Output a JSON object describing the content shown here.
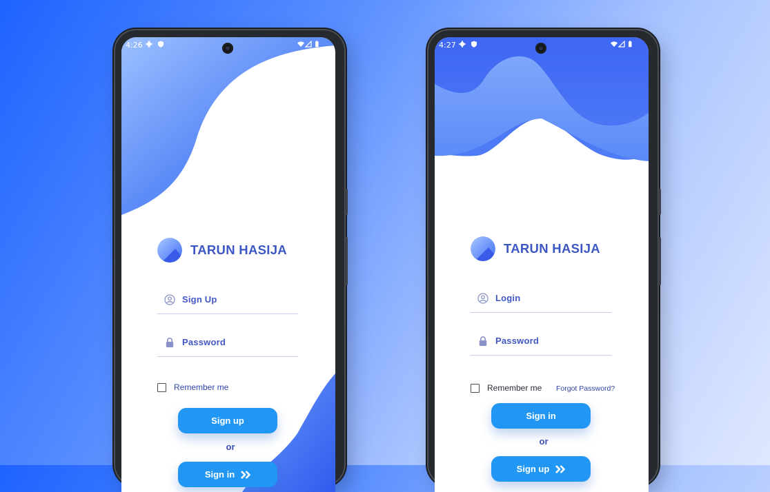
{
  "left_screen": {
    "status_time": "4:26",
    "brand_name": "TARUN HASIJA",
    "username_placeholder": "Sign Up",
    "password_placeholder": "Password",
    "remember_label": "Remember me",
    "primary_button": "Sign up",
    "or_label": "or",
    "secondary_button": "Sign in"
  },
  "right_screen": {
    "status_time": "4:27",
    "brand_name": "TARUN HASIJA",
    "username_placeholder": "Login",
    "password_placeholder": "Password",
    "remember_label": "Remember me",
    "forgot_label": "Forgot Password?",
    "primary_button": "Sign in",
    "or_label": "or",
    "secondary_button": "Sign up"
  },
  "icons": {
    "status": [
      "gear-icon",
      "shield-icon",
      "wifi-icon",
      "signal-icon",
      "battery-icon"
    ],
    "username_field": "user-circle-icon",
    "password_field": "lock-icon",
    "button_arrow": "double-chevron-right-icon"
  },
  "colors": {
    "brand_text": "#3c56c4",
    "wave_blue": "#3d6cf5",
    "button_blue": "#2196f3",
    "field_text": "#4257c4"
  }
}
